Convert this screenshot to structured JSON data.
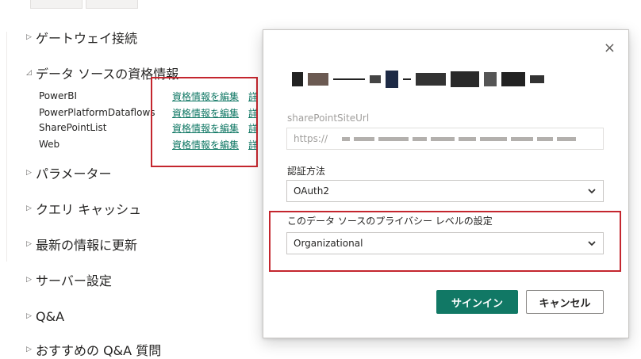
{
  "sections": [
    {
      "label": "ゲートウェイ接続",
      "expanded": false
    },
    {
      "label": "データ ソースの資格情報",
      "expanded": true
    },
    {
      "label": "パラメーター",
      "expanded": false
    },
    {
      "label": "クエリ キャッシュ",
      "expanded": false
    },
    {
      "label": "最新の情報に更新",
      "expanded": false
    },
    {
      "label": "サーバー設定",
      "expanded": false
    },
    {
      "label": "Q&A",
      "expanded": false
    },
    {
      "label": "おすすめの Q&A 質問",
      "expanded": false
    }
  ],
  "datasources": [
    {
      "name": "PowerBI",
      "edit_link": "資格情報を編集"
    },
    {
      "name": "PowerPlatformDataflows",
      "edit_link": "資格情報を編集"
    },
    {
      "name": "SharePointList",
      "edit_link": "資格情報を編集"
    },
    {
      "name": "Web",
      "edit_link": "資格情報を編集"
    }
  ],
  "dialog": {
    "close_label": "×",
    "site_url_label": "sharePointSiteUrl",
    "site_url_value": "https://",
    "auth_label": "認証方法",
    "auth_value": "OAuth2",
    "privacy_label": "このデータ ソースのプライバシー レベルの設定",
    "privacy_value": "Organizational",
    "signin_button": "サインイン",
    "cancel_button": "キャンセル"
  },
  "colors": {
    "accent": "#117865",
    "highlight": "#c4262e",
    "text": "#252423",
    "disabled": "#a19f9d"
  }
}
